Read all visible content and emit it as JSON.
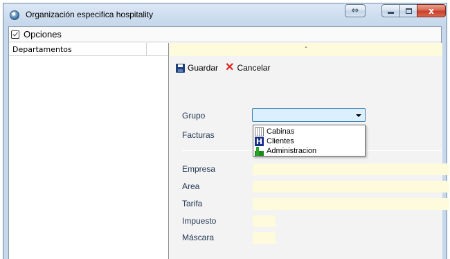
{
  "window": {
    "title": "Organización especifica hospitality",
    "close_glyph": "x",
    "swap_glyph": "⇔"
  },
  "menu": {
    "opciones_label": "Opciones"
  },
  "left_panel": {
    "header": "Departamentos"
  },
  "info_bar": {
    "text": "-"
  },
  "toolbar": {
    "save_label": "Guardar",
    "cancel_label": "Cancelar",
    "cancel_glyph": "✕"
  },
  "form": {
    "grupo_label": "Grupo",
    "grupo_value": "",
    "facturas_label": "Facturas",
    "empresa_label": "Empresa",
    "area_label": "Area",
    "tarifa_label": "Tarifa",
    "impuesto_label": "Impuesto",
    "mascara_label": "Máscara"
  },
  "dropdown": {
    "options": [
      {
        "label": "Cabinas",
        "icon": "cabinas-icon"
      },
      {
        "label": "Clientes",
        "icon": "hotel-icon",
        "glyph": "H"
      },
      {
        "label": "Administracion",
        "icon": "chart-icon"
      }
    ]
  },
  "colors": {
    "field_yellow": "#fdfbdc",
    "select_focus": "#dcefff",
    "cancel_red": "#e2211c",
    "label_blue": "#1f3552"
  }
}
